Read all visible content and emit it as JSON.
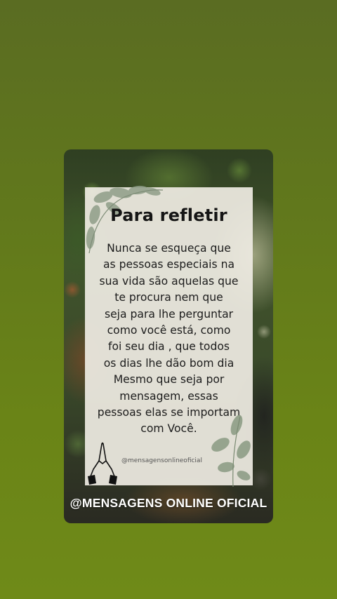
{
  "card": {
    "title": "Para refletir",
    "body_lines": [
      "Nunca se esqueça que",
      "as pessoas especiais na",
      "sua vida são aquelas que",
      "te procura nem que",
      "seja para lhe perguntar",
      "como você está, como",
      "foi seu dia , que todos",
      "os dias lhe dão bom dia",
      "Mesmo que seja por",
      "mensagem, essas",
      "pessoas elas se importam",
      "com Você."
    ],
    "handle": "@mensagensonlineoficial"
  },
  "footer": {
    "label": "@MENSAGENS ONLINE OFICIAL"
  },
  "icons": [
    "leaf-branch-icon",
    "leaf-branch-icon",
    "praying-hands-icon"
  ],
  "colors": {
    "background_green": "#61781c",
    "panel": "#eeebe2",
    "text": "#151515",
    "footer_text": "#ffffff"
  }
}
